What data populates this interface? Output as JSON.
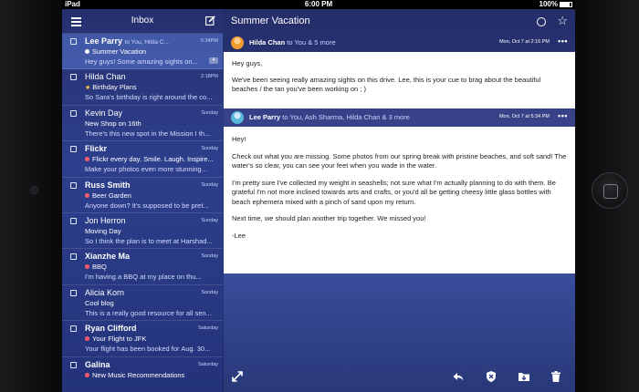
{
  "status_bar": {
    "carrier": "iPad",
    "time": "6:00 PM",
    "battery": "100%"
  },
  "list": {
    "title": "Inbox",
    "messages": [
      {
        "sender": "Lee Parry",
        "to": "to You, Hilda C...",
        "time": "5:34PM",
        "subject": "Summer Vacation",
        "preview": "Hey guys! Some amazing sights on...",
        "marker": "white-dot",
        "badge": "4",
        "bold": true,
        "selected": true
      },
      {
        "sender": "Hilda Chan",
        "to": "",
        "time": "2:18PM",
        "subject": "Birthday Plans",
        "preview": "So Sara's birthday is right around the co...",
        "marker": "star",
        "badge": "",
        "bold": false,
        "selected": false
      },
      {
        "sender": "Kevin Day",
        "to": "",
        "time": "Sunday",
        "subject": "New Shop on 16th",
        "preview": "There's this new spot in the Mission I th...",
        "marker": "",
        "badge": "",
        "bold": false,
        "selected": false
      },
      {
        "sender": "Flickr",
        "to": "",
        "time": "Sunday",
        "subject": "Flickr every day. Smile. Laugh. Inspire...",
        "preview": "Make your photos even more stunning...",
        "marker": "red-dot",
        "badge": "",
        "bold": true,
        "selected": false
      },
      {
        "sender": "Russ Smith",
        "to": "",
        "time": "Sunday",
        "subject": "Beer Garden",
        "preview": "Anyone down? It's supposed to be pret...",
        "marker": "red-dot",
        "badge": "",
        "bold": true,
        "selected": false
      },
      {
        "sender": "Jon Herron",
        "to": "",
        "time": "Sunday",
        "subject": "Moving Day",
        "preview": "So I think the plan is to meet at Harshad...",
        "marker": "",
        "badge": "",
        "bold": false,
        "selected": false
      },
      {
        "sender": "Xianzhe Ma",
        "to": "",
        "time": "Sunday",
        "subject": "BBQ",
        "preview": "I'm having a BBQ at my place on thu...",
        "marker": "red-dot",
        "badge": "",
        "bold": true,
        "selected": false
      },
      {
        "sender": "Alicia Korn",
        "to": "",
        "time": "Sunday",
        "subject": "Cool blog",
        "preview": "This is a really good resource for all sen...",
        "marker": "",
        "badge": "",
        "bold": false,
        "selected": false
      },
      {
        "sender": "Ryan Clifford",
        "to": "",
        "time": "Saturday",
        "subject": "Your Flight to JFK",
        "preview": "Your flight has been booked for Aug. 30...",
        "marker": "red-dot",
        "badge": "",
        "bold": true,
        "selected": false
      },
      {
        "sender": "Galina",
        "to": "",
        "time": "Saturday",
        "subject": "New Music Recommendations",
        "preview": "",
        "marker": "red-dot",
        "badge": "",
        "bold": true,
        "selected": false
      }
    ]
  },
  "detail": {
    "title": "Summer Vacation",
    "thread1": {
      "from": "Hilda Chan",
      "to": "to You & 5 more",
      "date": "Mon, Oct 7 at 2:16 PM",
      "more": "•••",
      "lines": [
        "Hey guys,",
        "We've been seeing really amazing sights on this drive. Lee, this is your cue to brag about the beautiful beaches / the tan you've been working on ; )"
      ]
    },
    "thread2": {
      "from": "Lee Parry",
      "to": "to You, Ash Sharma, Hilda Chan & 3 more",
      "date": "Mon, Oct 7 at 5:34 PM",
      "more": "•••",
      "lines": [
        "Hey!",
        "Check out what you are missing. Some photos from our spring break with pristine beaches, and soft sand! The water's so clear, you can see your feet when you wade in the water.",
        "I'm pretty sure I've collected my weight in seashells; not sure what I'm actually planning to do with them. Be grateful I'm not more inclined towards arts and crafts, or you'd all be getting cheesy little glass bottles with beach ephemera mixed with a pinch of sand upon my return.",
        "Next time, we should plan another trip together. We missed you!",
        "-Lee"
      ]
    }
  },
  "icons": {
    "menu": "hamburger-icon",
    "compose": "compose-icon",
    "unread": "circle-icon",
    "star": "star-icon",
    "expand": "expand-icon",
    "reply": "reply-icon",
    "spam": "shield-icon",
    "move": "folder-icon",
    "trash": "trash-icon"
  },
  "colors": {
    "accent_red": "#ff5a6a",
    "star_yellow": "#ffd23a",
    "selected_row": "#5878d2"
  }
}
